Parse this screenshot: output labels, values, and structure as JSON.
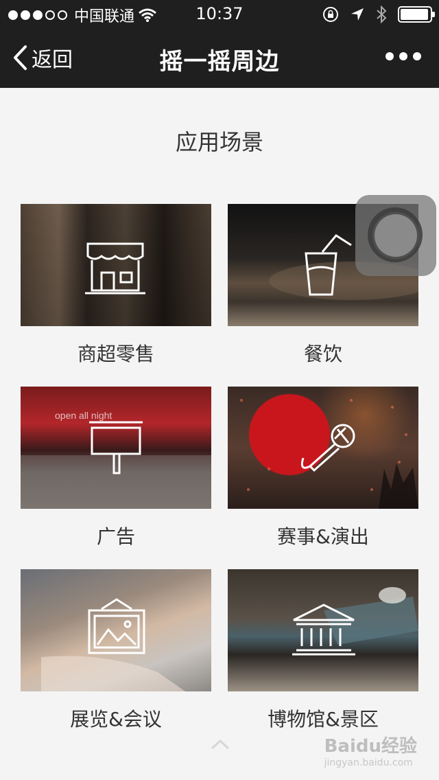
{
  "status_bar": {
    "carrier": "中国联通",
    "time": "10:37"
  },
  "nav": {
    "back_label": "返回",
    "title": "摇一摇周边"
  },
  "section_title": "应用场景",
  "tiles": [
    {
      "label": "商超零售",
      "icon": "storefront-icon"
    },
    {
      "label": "餐饮",
      "icon": "drink-cup-icon"
    },
    {
      "label": "广告",
      "icon": "billboard-icon"
    },
    {
      "label": "赛事&演出",
      "icon": "microphone-icon"
    },
    {
      "label": "展览&会议",
      "icon": "picture-frame-icon"
    },
    {
      "label": "博物馆&景区",
      "icon": "museum-icon"
    }
  ],
  "photo_text": {
    "ad_sign": "open all night"
  },
  "watermark": {
    "brand": "Baidu经验",
    "url": "jingyan.baidu.com"
  }
}
